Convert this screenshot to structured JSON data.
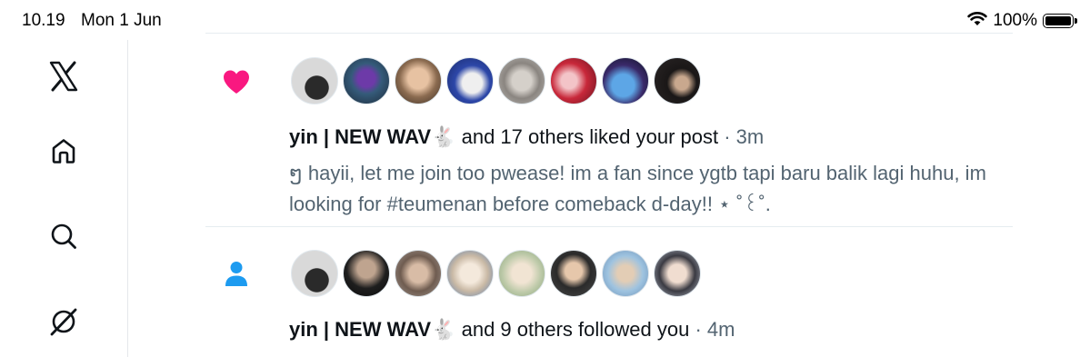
{
  "status_bar": {
    "time": "10.19",
    "date": "Mon 1 Jun",
    "battery_percent": "100%"
  },
  "sidebar": {
    "items": [
      "x-logo-icon",
      "home-icon",
      "search-icon",
      "grok-icon"
    ]
  },
  "colors": {
    "like": "#f91880",
    "follow": "#1d9bf0",
    "secondary_text": "#536471",
    "divider": "#e6ecf0"
  },
  "notifications": [
    {
      "type": "like",
      "icon": "heart-icon",
      "avatar_count": 8,
      "user": "yin | NEW WAV🐇",
      "action": " and 17 others liked your post",
      "separator": " · ",
      "time": "3m",
      "post_text": "ໆ hayii, let me join too pwease! im a fan since ygtb tapi baru balik lagi huhu, im looking for #teumenan before comeback d-day!! ⋆ ˚꒰˚."
    },
    {
      "type": "follow",
      "icon": "person-icon",
      "avatar_count": 8,
      "user": "yin | NEW WAV🐇",
      "action": " and 9 others followed you",
      "separator": " · ",
      "time": "4m"
    }
  ]
}
